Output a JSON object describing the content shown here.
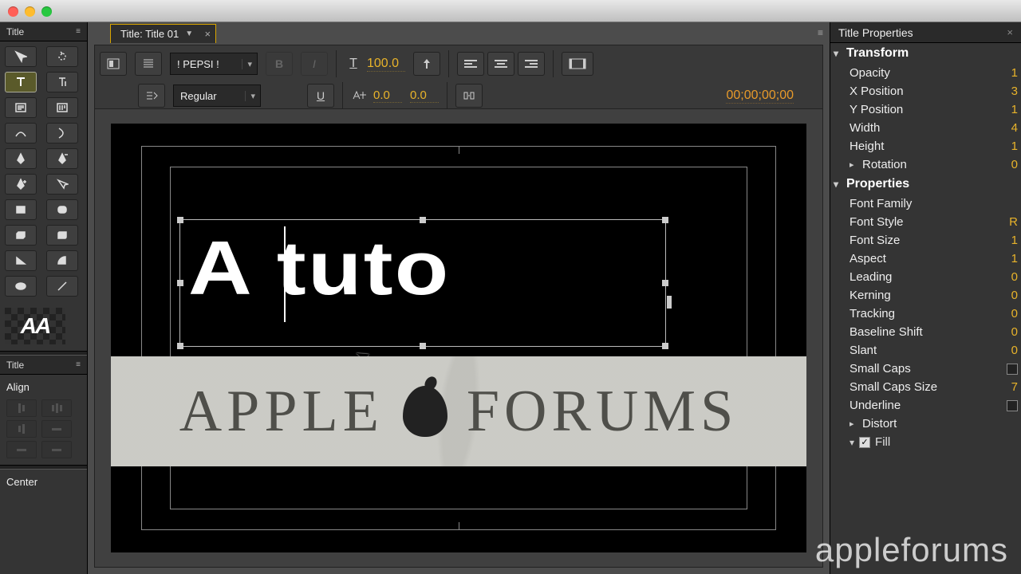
{
  "mac": {
    "buttons": [
      "close",
      "minimize",
      "zoom"
    ]
  },
  "panels": {
    "tool_tab": "Title",
    "styles_tab": "Title",
    "align_header": "Align",
    "center_header": "Center"
  },
  "document": {
    "tab_label": "Title: Title 01"
  },
  "toolbar": {
    "font_family": "! PEPSI !",
    "font_style": "Regular",
    "font_size": "100.0",
    "kerning": "0.0",
    "leading": "0.0",
    "bold": "B",
    "italic": "I",
    "underline": "U",
    "timecode": "00;00;00;00"
  },
  "canvas": {
    "editing_text": "A tuto",
    "banner_left": "APPLE",
    "banner_right": "FORUMS"
  },
  "properties": {
    "panel_title": "Title Properties",
    "sections": {
      "transform": "Transform",
      "properties": "Properties"
    },
    "transform": {
      "opacity": {
        "label": "Opacity",
        "value": "1"
      },
      "x_position": {
        "label": "X Position",
        "value": "3"
      },
      "y_position": {
        "label": "Y Position",
        "value": "1"
      },
      "width": {
        "label": "Width",
        "value": "4"
      },
      "height": {
        "label": "Height",
        "value": "1"
      },
      "rotation": {
        "label": "Rotation",
        "value": "0"
      }
    },
    "props": {
      "font_family": {
        "label": "Font Family",
        "value": ""
      },
      "font_style": {
        "label": "Font Style",
        "value": "R"
      },
      "font_size": {
        "label": "Font Size",
        "value": "1"
      },
      "aspect": {
        "label": "Aspect",
        "value": "1"
      },
      "leading": {
        "label": "Leading",
        "value": "0"
      },
      "kerning": {
        "label": "Kerning",
        "value": "0"
      },
      "tracking": {
        "label": "Tracking",
        "value": "0"
      },
      "baseline_shift": {
        "label": "Baseline Shift",
        "value": "0"
      },
      "slant": {
        "label": "Slant",
        "value": "0"
      },
      "small_caps": {
        "label": "Small Caps",
        "value": ""
      },
      "small_caps_size": {
        "label": "Small Caps Size",
        "value": "7"
      },
      "underline": {
        "label": "Underline",
        "value": ""
      },
      "distort": {
        "label": "Distort",
        "value": ""
      },
      "fill": {
        "label": "Fill",
        "value": ""
      }
    }
  },
  "watermark": "appleforums"
}
